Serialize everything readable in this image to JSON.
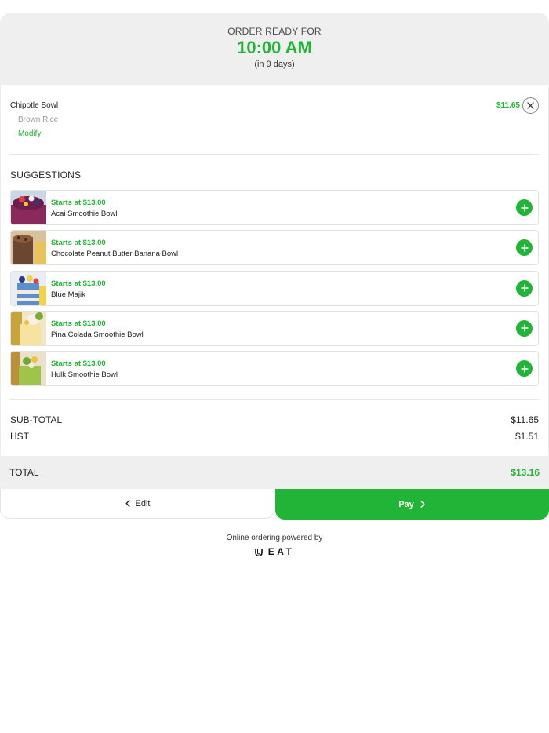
{
  "header": {
    "ready_label": "ORDER READY FOR",
    "ready_time": "10:00 AM",
    "ready_days": "(in 9 days)"
  },
  "cart_item": {
    "name": "Chipotle Bowl",
    "price": "$11.65",
    "modifier": "Brown Rice",
    "modify_label": "Modify",
    "remove_icon": "close-icon"
  },
  "suggestions": {
    "title": "SUGGESTIONS",
    "items": [
      {
        "price": "Starts at $13.00",
        "name": "Acai Smoothie Bowl"
      },
      {
        "price": "Starts at $13.00",
        "name": "Chocolate Peanut Butter Banana Bowl"
      },
      {
        "price": "Starts at $13.00",
        "name": "Blue Majik"
      },
      {
        "price": "Starts at $13.00",
        "name": "Pina Colada Smoothie Bowl"
      },
      {
        "price": "Starts at $13.00",
        "name": "Hulk Smoothie Bowl"
      }
    ]
  },
  "summary": {
    "subtotal_label": "SUB-TOTAL",
    "subtotal_value": "$11.65",
    "tax_label": "HST",
    "tax_value": "$1.51",
    "total_label": "TOTAL",
    "total_value": "$13.16"
  },
  "actions": {
    "edit_label": "Edit",
    "pay_label": "Pay"
  },
  "footer": {
    "powered_by": "Online ordering powered by",
    "brand": "EAT"
  },
  "colors": {
    "accent": "#22b436",
    "header_bg": "#efefef"
  }
}
